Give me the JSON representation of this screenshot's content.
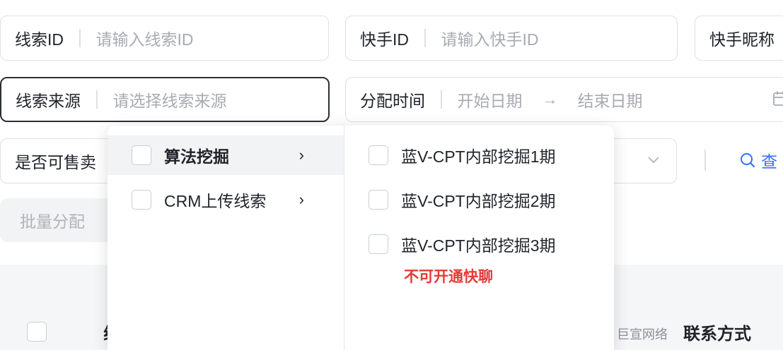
{
  "filters": {
    "lead_id": {
      "label": "线索ID",
      "placeholder": "请输入线索ID"
    },
    "kuaishou_id": {
      "label": "快手ID",
      "placeholder": "请输入快手ID"
    },
    "kuaishou_nickname": {
      "label": "快手昵称"
    },
    "lead_source": {
      "label": "线索来源",
      "placeholder": "请选择线索来源"
    },
    "assign_time": {
      "label": "分配时间",
      "start_placeholder": "开始日期",
      "end_placeholder": "结束日期",
      "arrow": "→"
    },
    "sellable": {
      "label": "是否可售卖"
    }
  },
  "actions": {
    "search_label": "查",
    "batch_assign_label": "批量分配"
  },
  "cascader": {
    "level1": [
      {
        "label": "算法挖掘",
        "caret": "›",
        "active": true
      },
      {
        "label": "CRM上传线索",
        "caret": "›",
        "active": false
      }
    ],
    "level2": [
      {
        "label": "蓝V-CPT内部挖掘1期"
      },
      {
        "label": "蓝V-CPT内部挖掘2期"
      },
      {
        "label": "蓝V-CPT内部挖掘3期"
      }
    ],
    "note": "不可开通快聊"
  },
  "table": {
    "first_col": "线",
    "contact_col": "联系方式"
  },
  "watermark": {
    "brand": "巨宣网络"
  },
  "colors": {
    "accent": "#3370ff",
    "note": "#e53935",
    "border": "#dcdfe6"
  }
}
